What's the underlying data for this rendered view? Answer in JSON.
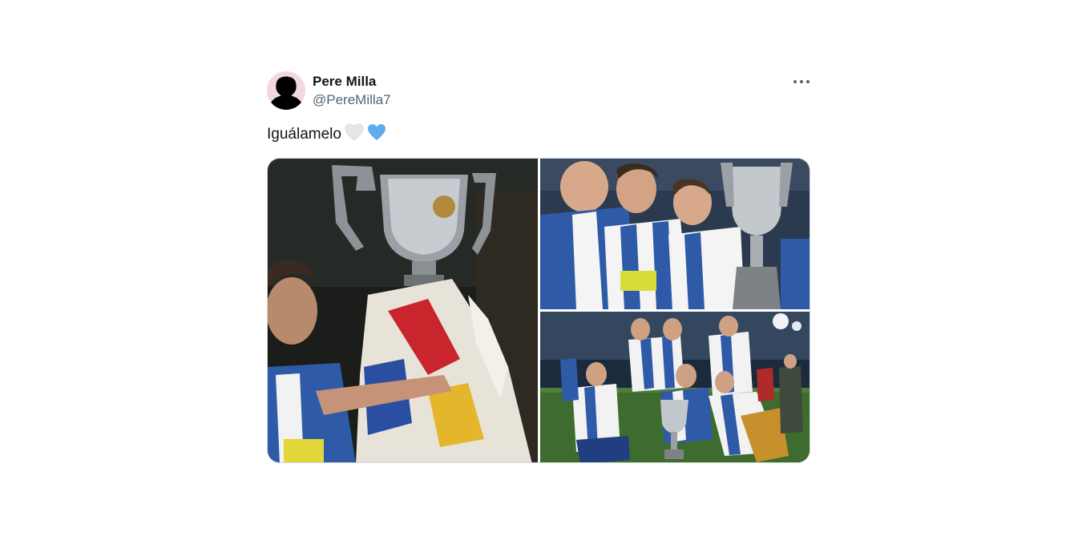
{
  "tweet": {
    "author": {
      "display_name": "Pere Milla",
      "handle": "@PereMilla7",
      "avatar_icon": "silhouette-avatar"
    },
    "more_icon": "more-options-icon",
    "text": "Iguálamelo",
    "emojis": [
      "white-heart-emoji",
      "blue-heart-emoji"
    ],
    "media": [
      {
        "name": "photo-trophy-celebration-1",
        "icon": "photo"
      },
      {
        "name": "photo-trophy-celebration-2",
        "icon": "photo"
      },
      {
        "name": "photo-team-celebration",
        "icon": "photo"
      }
    ]
  },
  "colors": {
    "text_primary": "#0f1419",
    "text_secondary": "#536471",
    "border": "#cfd9de",
    "blue_heart": "#5dadec",
    "white_heart": "#e6e6e6"
  }
}
